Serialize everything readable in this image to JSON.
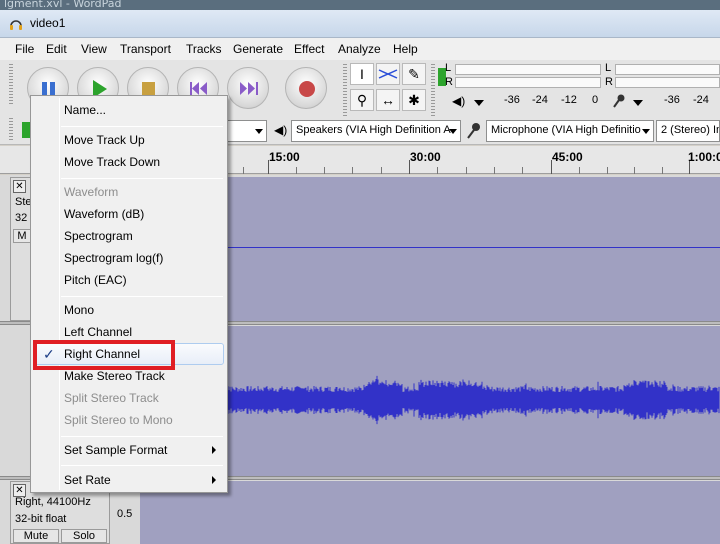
{
  "background": {
    "text": "lgment.xvl - WordPad"
  },
  "window": {
    "title": "video1"
  },
  "menu": [
    "File",
    "Edit",
    "View",
    "Transport",
    "Tracks",
    "Generate",
    "Effect",
    "Analyze",
    "Help"
  ],
  "meters": {
    "playback": {
      "l": "L",
      "r": "R"
    },
    "record": {
      "l": "L",
      "r": "R"
    },
    "playback_scale": [
      "-36",
      "-24",
      "-12",
      "0"
    ],
    "record_scale": [
      "-36",
      "-24"
    ]
  },
  "devices": {
    "speaker": "Speakers (VIA High Definition A",
    "microphone": "Microphone (VIA High Definitio",
    "channels": "2 (Stereo) In"
  },
  "ruler": {
    "labels": [
      "15:00",
      "30:00",
      "45:00",
      "1:00:0"
    ]
  },
  "track_top": {
    "name": "Ste",
    "rate": "32",
    "mute": "M"
  },
  "track_bottom": {
    "channel": "Right, 44100Hz",
    "format": "32-bit float",
    "mute": "Mute",
    "solo": "Solo",
    "scale": "0.5"
  },
  "context_menu": {
    "name": "Name...",
    "move_up": "Move Track Up",
    "move_down": "Move Track Down",
    "waveform": "Waveform",
    "waveform_db": "Waveform (dB)",
    "spectrogram": "Spectrogram",
    "spectrogram_log": "Spectrogram log(f)",
    "pitch": "Pitch (EAC)",
    "mono": "Mono",
    "left": "Left Channel",
    "right": "Right Channel",
    "make_stereo": "Make Stereo Track",
    "split_stereo": "Split Stereo Track",
    "split_mono": "Split Stereo to Mono",
    "sample_format": "Set Sample Format",
    "set_rate": "Set Rate",
    "check_mark": "✓"
  },
  "colors": {
    "waveform": "#3232c8",
    "highlight_box": "#e01e24",
    "record_button": "#c84848"
  }
}
